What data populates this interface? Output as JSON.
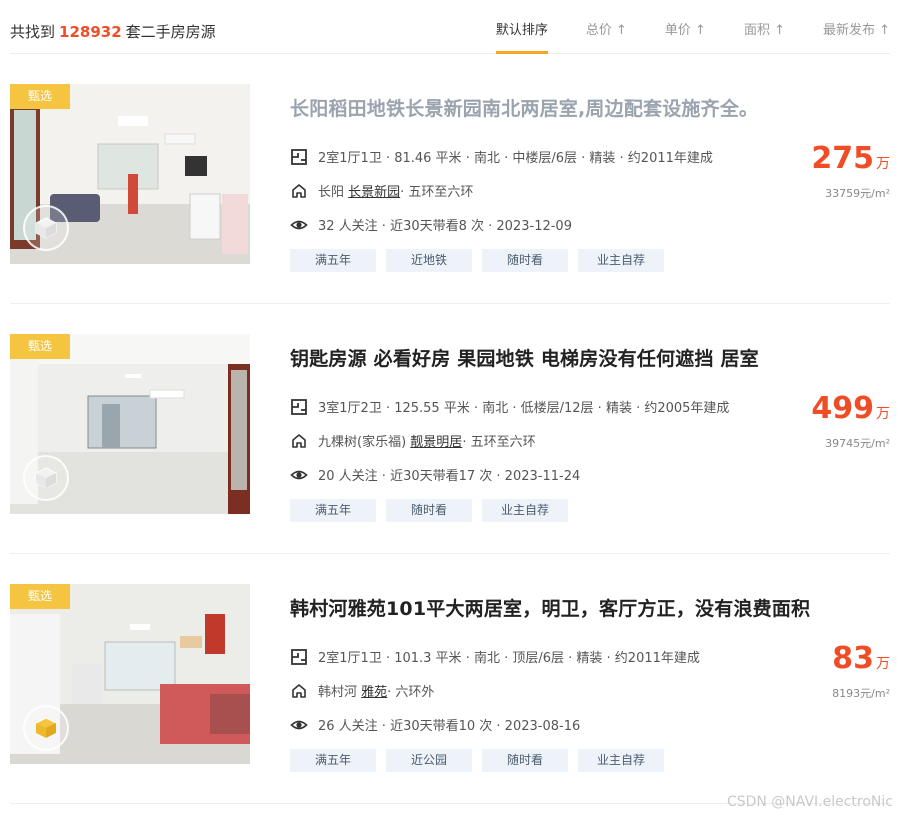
{
  "header": {
    "count_prefix": "共找到",
    "count": "128932",
    "count_suffix": "套二手房房源",
    "sorts": [
      {
        "label": "默认排序",
        "active": true
      },
      {
        "label": "总价 ↑"
      },
      {
        "label": "单价 ↑"
      },
      {
        "label": "面积 ↑"
      },
      {
        "label": "最新发布 ↑"
      }
    ]
  },
  "listings": [
    {
      "badge": "甄选",
      "title": "长阳稻田地铁长景新园南北两居室,周边配套设施齐全。",
      "visited": true,
      "specs": "2室1厅1卫 · 81.46 平米 · 南北 · 中楼层/6层 · 精装 · 约2011年建成",
      "area": "长阳",
      "community": "长景新园",
      "ring": " · 五环至六环",
      "follow": "32 人关注 · 近30天带看8 次 · 2023-12-09",
      "tags": [
        "满五年",
        "近地铁",
        "随时看",
        "业主自荐"
      ],
      "total_price": "275",
      "price_unit": "万",
      "unit_price": "33759元/m²"
    },
    {
      "badge": "甄选",
      "title": "钥匙房源 必看好房 果园地铁 电梯房没有任何遮挡 居室",
      "visited": false,
      "specs": "3室1厅2卫 · 125.55 平米 · 南北 · 低楼层/12层 · 精装 · 约2005年建成",
      "area": "九棵树(家乐福)",
      "community": "靓景明居",
      "ring": " · 五环至六环",
      "follow": "20 人关注 · 近30天带看17 次 · 2023-11-24",
      "tags": [
        "满五年",
        "随时看",
        "业主自荐"
      ],
      "total_price": "499",
      "price_unit": "万",
      "unit_price": "39745元/m²"
    },
    {
      "badge": "甄选",
      "title": "韩村河雅苑101平大两居室，明卫，客厅方正，没有浪费面积",
      "visited": false,
      "specs": "2室1厅1卫 · 101.3 平米 · 南北 · 顶层/6层 · 精装 · 约2011年建成",
      "area": "韩村河",
      "community": "雅苑",
      "ring": " · 六环外",
      "follow": "26 人关注 · 近30天带看10 次 · 2023-08-16",
      "tags": [
        "满五年",
        "近公园",
        "随时看",
        "业主自荐"
      ],
      "total_price": "83",
      "price_unit": "万",
      "unit_price": "8193元/m²"
    }
  ],
  "watermark": "CSDN @NAVI.electroNic",
  "colors": {
    "accent": "#f5a623",
    "price": "#f04d27",
    "badge": "#f5c542",
    "tag_bg": "#eef3f9"
  }
}
